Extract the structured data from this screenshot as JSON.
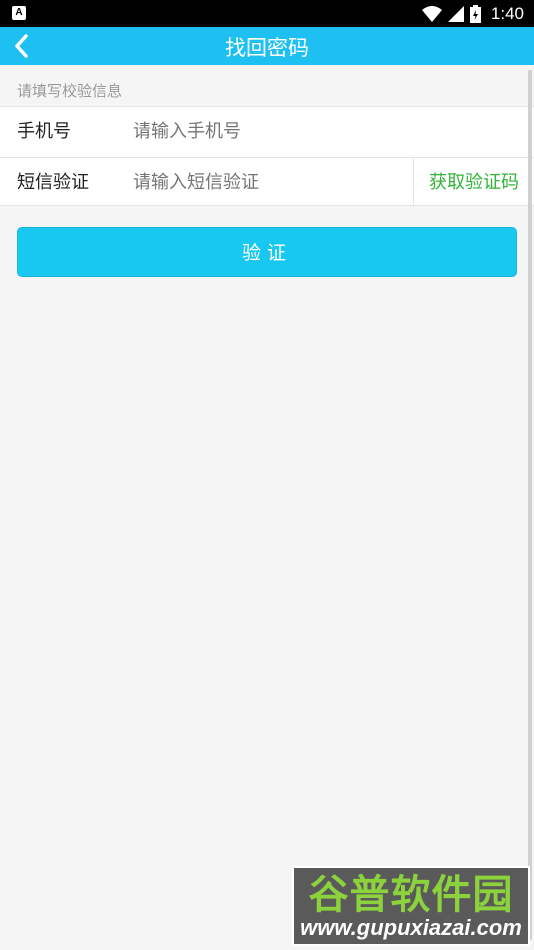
{
  "status_bar": {
    "time": "1:40",
    "icons": [
      "wifi-icon",
      "signal-icon",
      "battery-icon"
    ]
  },
  "header": {
    "title": "找回密码",
    "back_icon": "chevron-left-icon"
  },
  "form": {
    "section_label": "请填写校验信息",
    "phone": {
      "label": "手机号",
      "placeholder": "请输入手机号"
    },
    "sms_code": {
      "label": "短信验证",
      "placeholder": "请输入短信验证",
      "get_code_label": "获取验证码"
    }
  },
  "verify_button_label": "验证",
  "watermark": {
    "title": "谷普软件园",
    "url": "www.gupuxiazai.com"
  },
  "colors": {
    "header": "#1ec0f2",
    "button": "#19c8f0",
    "get_code": "#31b43a",
    "background": "#f5f5f5"
  }
}
